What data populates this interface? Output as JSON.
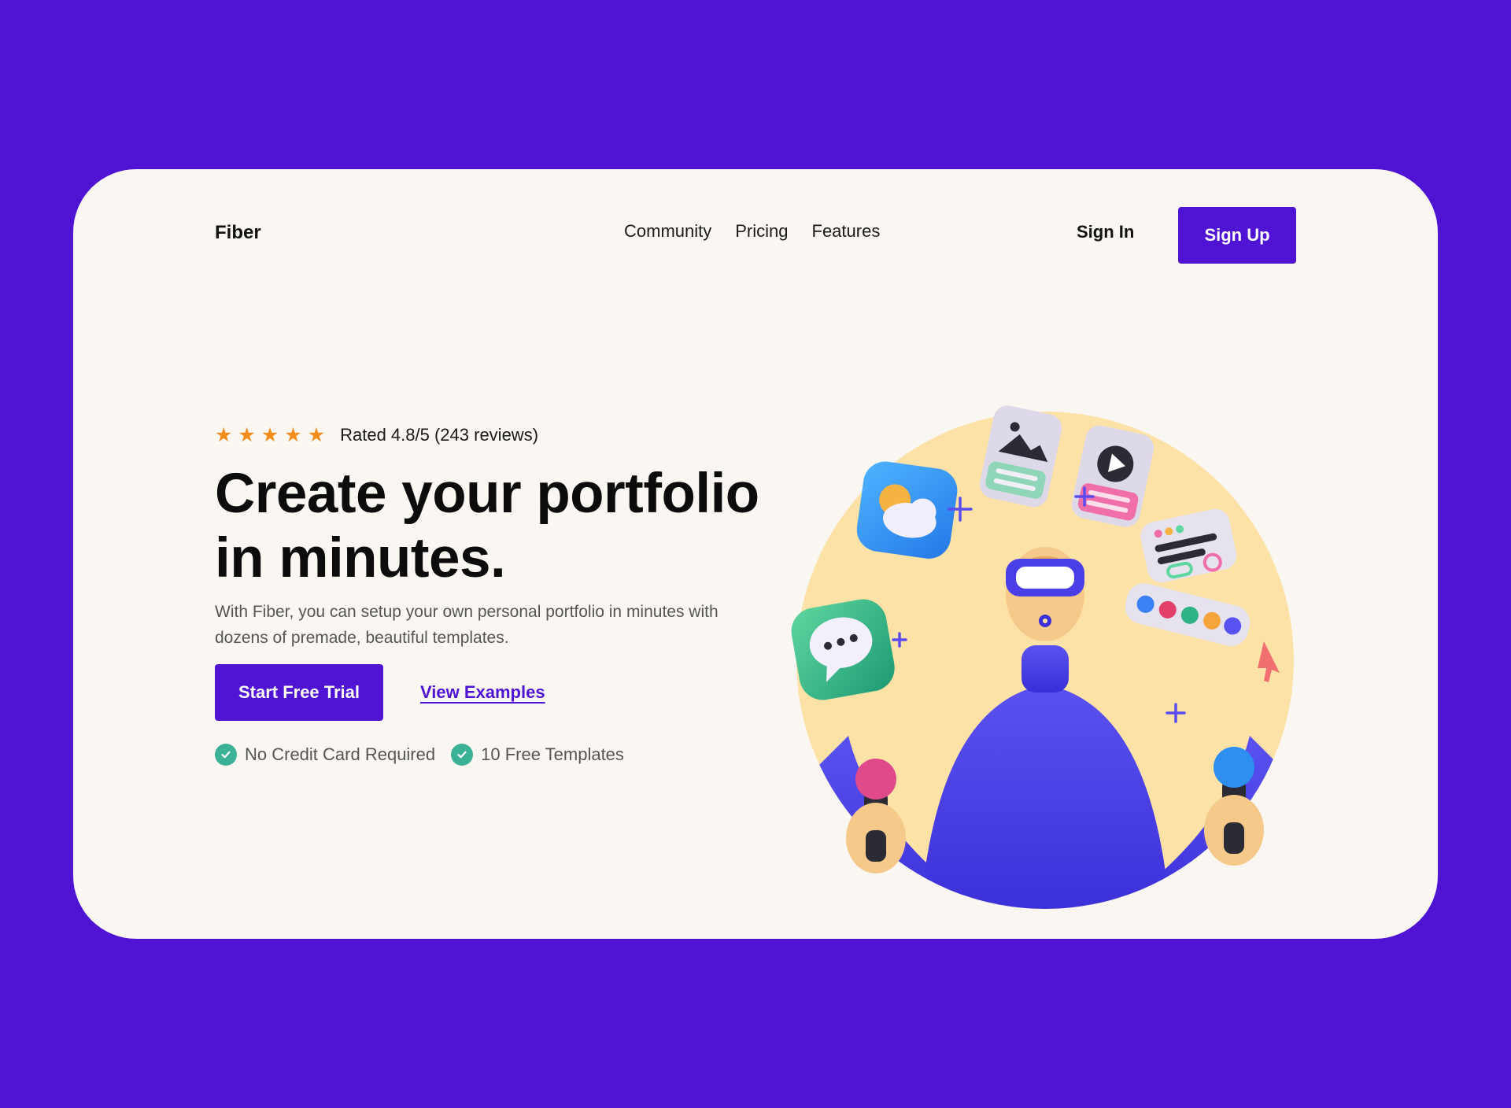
{
  "header": {
    "logo": "Fiber",
    "nav": [
      "Community",
      "Pricing",
      "Features"
    ],
    "sign_in": "Sign In",
    "sign_up": "Sign Up"
  },
  "hero": {
    "stars": 5,
    "rating_text": "Rated 4.8/5 (243 reviews)",
    "headline_line1": "Create your portfolio",
    "headline_line2": "in minutes.",
    "description": "With Fiber, you can setup your own personal portfolio in minutes with dozens of premade, beautiful templates.",
    "cta_primary": "Start Free Trial",
    "cta_secondary": "View Examples",
    "features": [
      "No Credit Card Required",
      "10 Free Templates"
    ]
  },
  "colors": {
    "background": "#4f13d4",
    "card": "#faf7f2",
    "accent": "#4f13d4",
    "star": "#f28c1b",
    "check": "#3bb195",
    "circle": "#fde2a7"
  }
}
